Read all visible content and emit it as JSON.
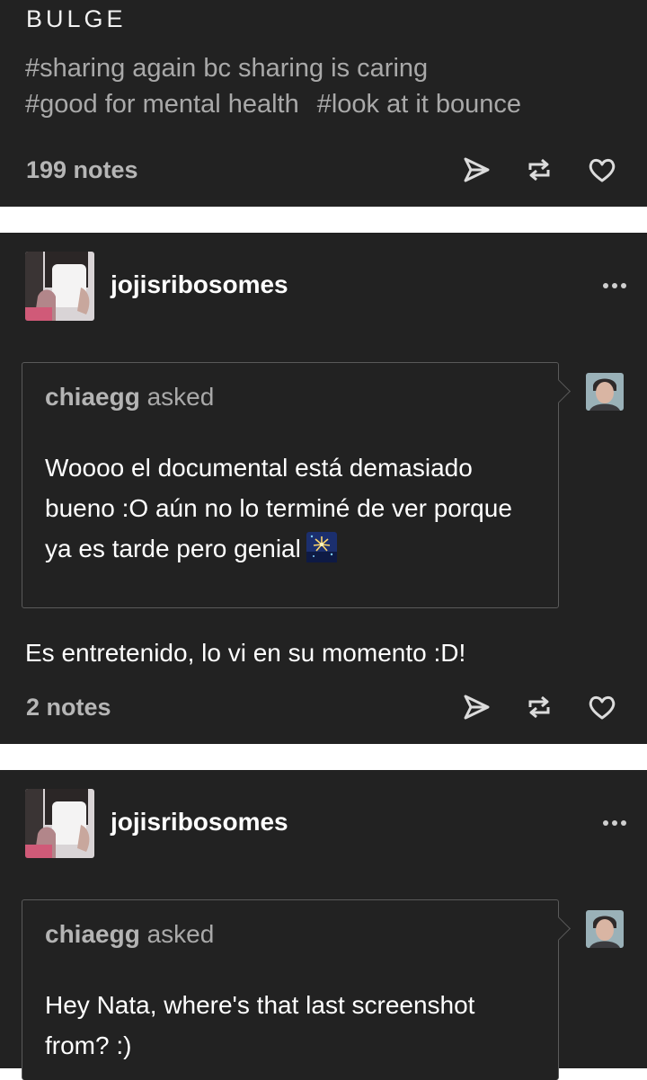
{
  "post1": {
    "title": "BULGE",
    "tags_line1": [
      "#sharing again bc sharing is caring"
    ],
    "tags_line2": [
      "#good for mental health",
      "#look at it bounce"
    ],
    "notes": "199 notes"
  },
  "post2": {
    "username": "jojisribosomes",
    "asker": "chiaegg",
    "asked_label": " asked",
    "question": "Woooo el documental está demasiado bueno :O aún no lo terminé de ver porque ya es tarde pero genial",
    "question_emoji": "fireworks-icon",
    "answer": "Es entretenido, lo vi en su momento :D!",
    "notes": "2 notes"
  },
  "post3": {
    "username": "jojisribosomes",
    "asker": "chiaegg",
    "asked_label": " asked",
    "question": "Hey Nata, where's that last screenshot from? :)"
  },
  "colors": {
    "card_bg": "#222222",
    "separator": "#ffffff",
    "muted_text": "#a9a9a9",
    "icon": "#dcdcdc"
  }
}
